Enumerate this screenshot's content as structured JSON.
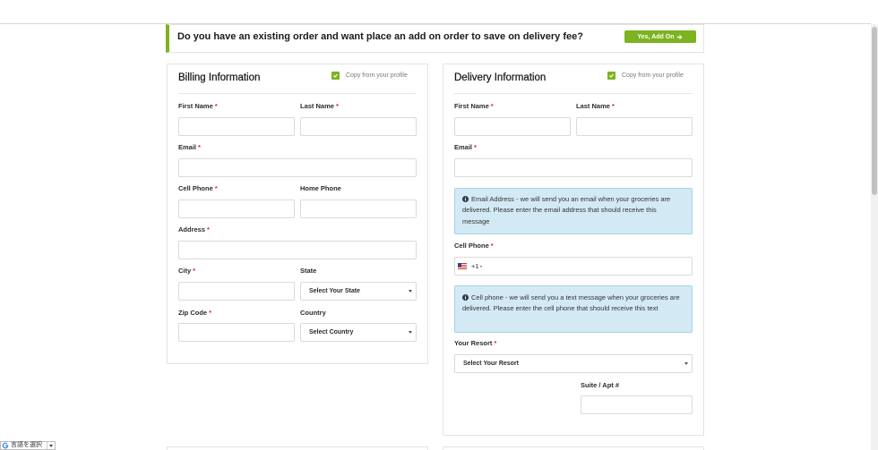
{
  "required_mark": "*",
  "colors": {
    "accent_green": "#7db320",
    "required_red": "#c9302c",
    "info_background": "#d3eaf5",
    "info_border": "#a6d2e9"
  },
  "banner": {
    "text": "Do you have an existing order and want place an add on order to save on delivery fee?",
    "button_label": "Yes, Add On",
    "button_icon": "arrow-right-icon"
  },
  "billing": {
    "title": "Billing Information",
    "copy_from_profile": {
      "label": "Copy from your profile",
      "checked": true
    },
    "first_name": {
      "label": "First Name",
      "required": true,
      "value": ""
    },
    "last_name": {
      "label": "Last Name",
      "required": true,
      "value": ""
    },
    "email": {
      "label": "Email",
      "required": true,
      "value": ""
    },
    "cell_phone": {
      "label": "Cell Phone",
      "required": true,
      "value": ""
    },
    "home_phone": {
      "label": "Home Phone",
      "required": false,
      "value": ""
    },
    "address": {
      "label": "Address",
      "required": true,
      "value": ""
    },
    "city": {
      "label": "City",
      "required": true,
      "value": ""
    },
    "state": {
      "label": "State",
      "required": false,
      "selected": "Select Your State"
    },
    "zip_code": {
      "label": "Zip Code",
      "required": true,
      "value": ""
    },
    "country": {
      "label": "Country",
      "required": false,
      "selected": "Select Country"
    }
  },
  "delivery": {
    "title": "Delivery Information",
    "copy_from_profile": {
      "label": "Copy from your profile",
      "checked": true
    },
    "first_name": {
      "label": "First Name",
      "required": true,
      "value": ""
    },
    "last_name": {
      "label": "Last Name",
      "required": true,
      "value": ""
    },
    "email": {
      "label": "Email",
      "required": true,
      "value": ""
    },
    "email_info": "Email Address - we will send you an email when your groceries are delivered. Please enter the email address that should receive this message",
    "cell_phone": {
      "label": "Cell Phone",
      "required": true,
      "country_flag": "us-flag-icon",
      "dial_code": "+1",
      "value": ""
    },
    "cell_phone_info": "Cell phone - we will send you a text message when your groceries are delivered. Please enter the cell phone that should receive this text",
    "resort": {
      "label": "Your Resort",
      "required": true,
      "selected": "Select Your Resort"
    },
    "suite_apt": {
      "label": "Suite / Apt #",
      "required": false,
      "value": ""
    }
  },
  "language_widget": {
    "logo": "G",
    "label": "言語を選択"
  }
}
